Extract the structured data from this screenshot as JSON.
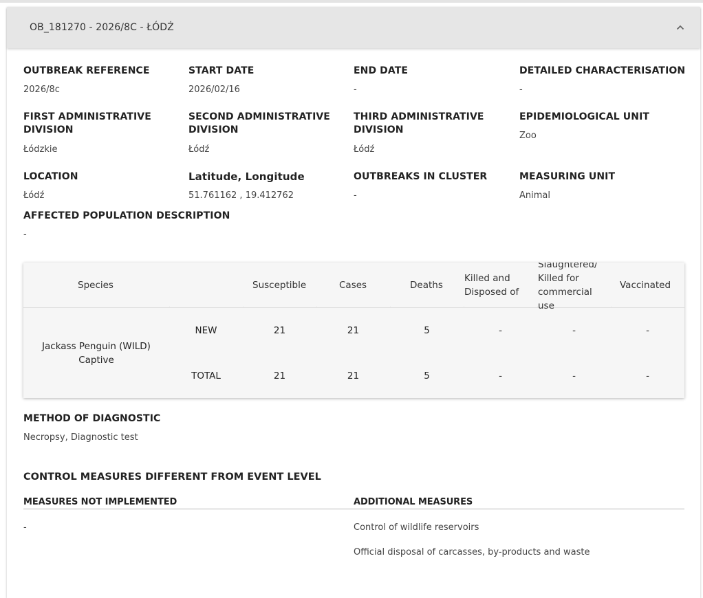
{
  "header": {
    "title": "OB_181270 - 2026/8C - ŁÓDŹ",
    "toggle_icon": "chevron-up-icon"
  },
  "details": {
    "outbreak_reference": {
      "label": "OUTBREAK REFERENCE",
      "value": "2026/8c"
    },
    "start_date": {
      "label": "START DATE",
      "value": "2026/02/16"
    },
    "end_date": {
      "label": "END DATE",
      "value": "-"
    },
    "detailed_characterisation": {
      "label": "DETAILED CHARACTERISATION",
      "value": "-"
    },
    "first_admin": {
      "label_line1": "FIRST ADMINISTRATIVE",
      "label_line2": "DIVISION",
      "value": "Łódzkie"
    },
    "second_admin": {
      "label_line1": "SECOND ADMINISTRATIVE",
      "label_line2": "DIVISION",
      "value": "Łódź"
    },
    "third_admin": {
      "label_line1": "THIRD ADMINISTRATIVE",
      "label_line2": "DIVISION",
      "value": "Łódź"
    },
    "epi_unit": {
      "label": "EPIDEMIOLOGICAL UNIT",
      "value": "Zoo"
    },
    "location": {
      "label": "LOCATION",
      "value": "Łódź"
    },
    "lat_long": {
      "label": "Latitude, Longitude",
      "value": "51.761162 , 19.412762"
    },
    "outbreaks_in_cluster": {
      "label": "OUTBREAKS IN CLUSTER",
      "value": "-"
    },
    "measuring_unit": {
      "label": "MEASURING UNIT",
      "value": "Animal"
    },
    "affected_population": {
      "label": "AFFECTED POPULATION DESCRIPTION",
      "value": "-"
    }
  },
  "table": {
    "headers": {
      "species": "Species",
      "susceptible": "Susceptible",
      "cases": "Cases",
      "deaths": "Deaths",
      "killed_line1": "Killed and",
      "killed_line2": "Disposed of",
      "slaughtered_line0": "Slaughtered/",
      "slaughtered_line1": "Killed for",
      "slaughtered_line2": "commercial",
      "slaughtered_line3": "use",
      "vaccinated": "Vaccinated"
    },
    "species_line1": "Jackass Penguin (WILD)",
    "species_line2": "Captive",
    "rows": [
      {
        "type": "NEW",
        "susceptible": "21",
        "cases": "21",
        "deaths": "5",
        "killed": "-",
        "slaughtered": "-",
        "vaccinated": "-"
      },
      {
        "type": "TOTAL",
        "susceptible": "21",
        "cases": "21",
        "deaths": "5",
        "killed": "-",
        "slaughtered": "-",
        "vaccinated": "-"
      }
    ]
  },
  "diagnostic": {
    "label": "METHOD OF DIAGNOSTIC",
    "value": "Necropsy, Diagnostic test"
  },
  "control": {
    "title": "CONTROL MEASURES DIFFERENT FROM EVENT LEVEL",
    "not_implemented_label": "MEASURES NOT IMPLEMENTED",
    "not_implemented_value": "-",
    "additional_label": "ADDITIONAL MEASURES",
    "additional_items": [
      "Control of wildlife reservoirs",
      "Official disposal of carcasses, by-products and waste"
    ]
  }
}
